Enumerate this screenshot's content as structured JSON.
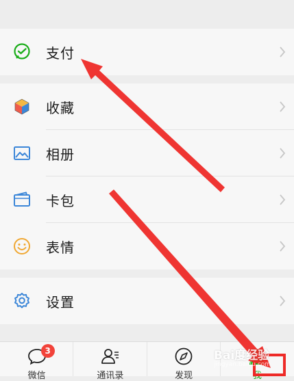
{
  "menu": {
    "pay": {
      "label": "支付",
      "icon": "wechat-pay-icon"
    },
    "favorites": {
      "label": "收藏",
      "icon": "cube-icon"
    },
    "album": {
      "label": "相册",
      "icon": "picture-icon"
    },
    "cards": {
      "label": "卡包",
      "icon": "wallet-icon"
    },
    "stickers": {
      "label": "表情",
      "icon": "smiley-icon"
    },
    "settings": {
      "label": "设置",
      "icon": "gear-icon"
    }
  },
  "tabbar": {
    "chats": {
      "label": "微信",
      "badge": "3",
      "icon": "chat-bubble-icon"
    },
    "contacts": {
      "label": "通讯录",
      "icon": "contacts-icon"
    },
    "discover": {
      "label": "发现",
      "icon": "compass-icon"
    },
    "me": {
      "label": "我",
      "icon": "person-icon"
    }
  },
  "watermark": {
    "text": "Bai度经验",
    "sub": "jingyan.baidu.com"
  },
  "colors": {
    "accent_green": "#1aad19",
    "arrow_red": "#ee2a27",
    "badge_red": "#f2433a",
    "icon_blue": "#3b86d8"
  }
}
